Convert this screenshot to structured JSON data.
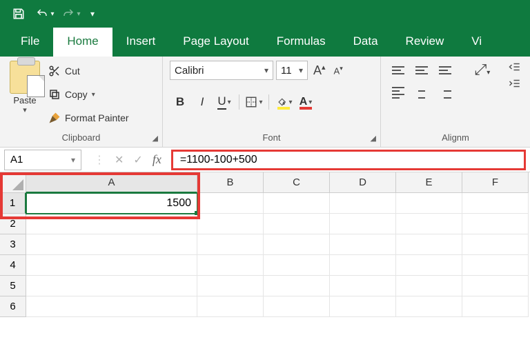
{
  "titlebar": {
    "save_title": "Save",
    "undo_title": "Undo",
    "redo_title": "Redo",
    "customize_title": "Customize Quick Access Toolbar"
  },
  "tabs": {
    "file": "File",
    "home": "Home",
    "insert": "Insert",
    "page_layout": "Page Layout",
    "formulas": "Formulas",
    "data": "Data",
    "review": "Review",
    "view_partial": "Vi"
  },
  "ribbon": {
    "clipboard": {
      "paste": "Paste",
      "cut": "Cut",
      "copy": "Copy",
      "format_painter": "Format Painter",
      "group_label": "Clipboard"
    },
    "font": {
      "name": "Calibri",
      "size": "11",
      "bold": "B",
      "italic": "I",
      "underline": "U",
      "group_label": "Font"
    },
    "alignment": {
      "group_label_partial": "Alignm"
    }
  },
  "formula_bar": {
    "name_box": "A1",
    "fx": "fx",
    "formula": "=1100-100+500"
  },
  "grid": {
    "columns": [
      "A",
      "B",
      "C",
      "D",
      "E",
      "F"
    ],
    "rows": [
      "1",
      "2",
      "3",
      "4",
      "5",
      "6"
    ],
    "cells": {
      "A1": "1500"
    }
  }
}
